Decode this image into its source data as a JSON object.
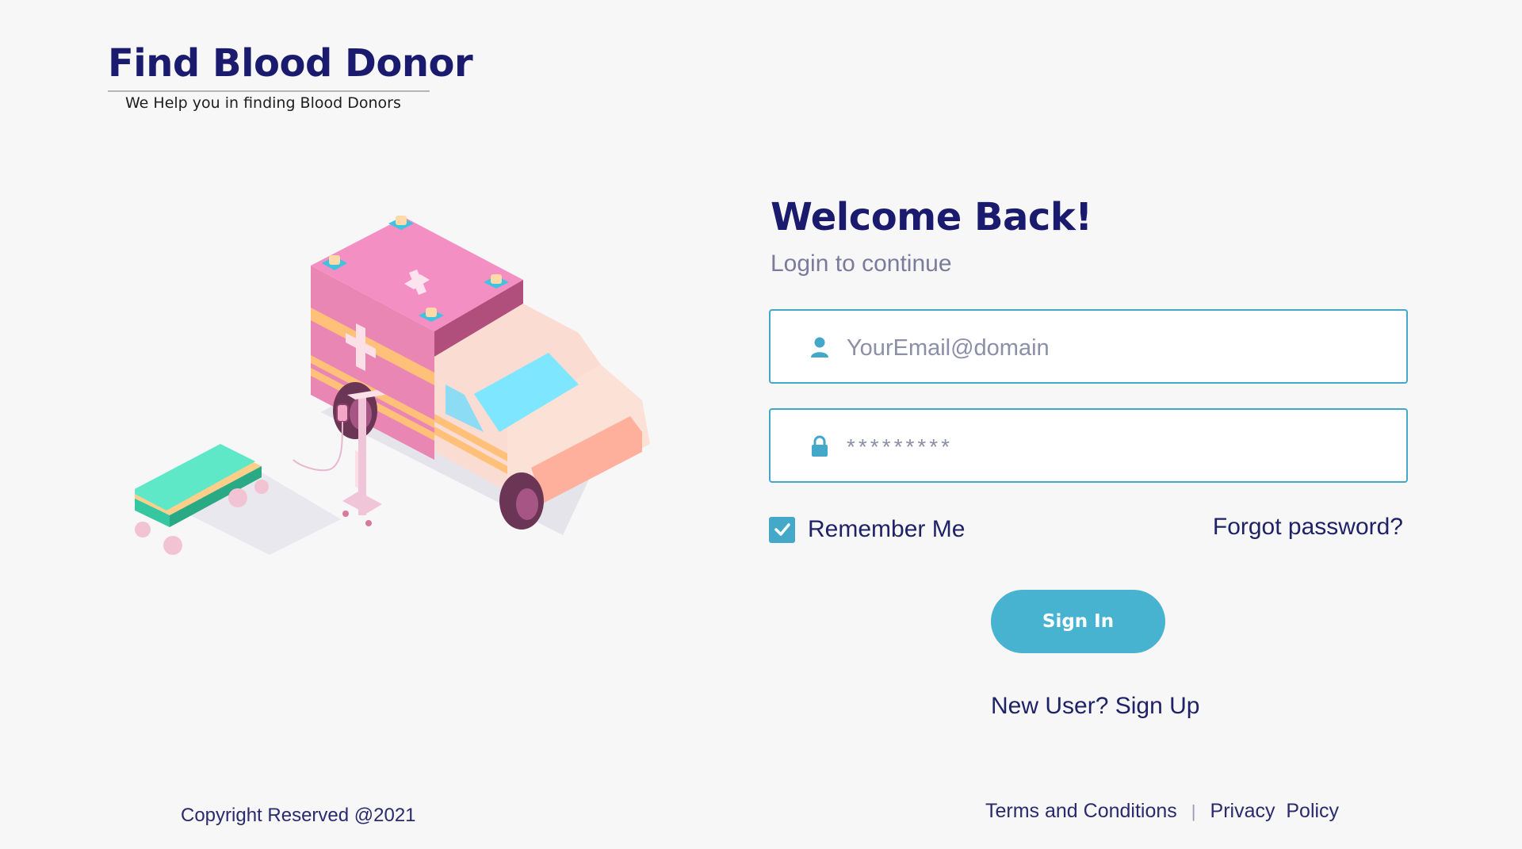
{
  "brand": {
    "title": "Find Blood Donor",
    "tagline": "We Help you in finding Blood Donors"
  },
  "login": {
    "title": "Welcome Back!",
    "subtitle": "Login to continue",
    "email_placeholder": "YourEmail@domain",
    "password_placeholder": "*********",
    "remember_label": "Remember Me",
    "remember_checked": true,
    "forgot_label": "Forgot password?",
    "signin_label": "Sign In",
    "signup_label": "New User? Sign Up"
  },
  "footer": {
    "copyright": "Copyright Reserved @2021",
    "terms_label": "Terms and Conditions",
    "separator": "|",
    "privacy_label": "Privacy  Policy"
  },
  "icons": {
    "email": "user-icon",
    "password": "lock-icon",
    "checkbox": "check-icon"
  },
  "colors": {
    "brand": "#1a1a6e",
    "accent": "#47b3d1",
    "field_border": "#44a8c8",
    "background": "#f7f7f7"
  }
}
